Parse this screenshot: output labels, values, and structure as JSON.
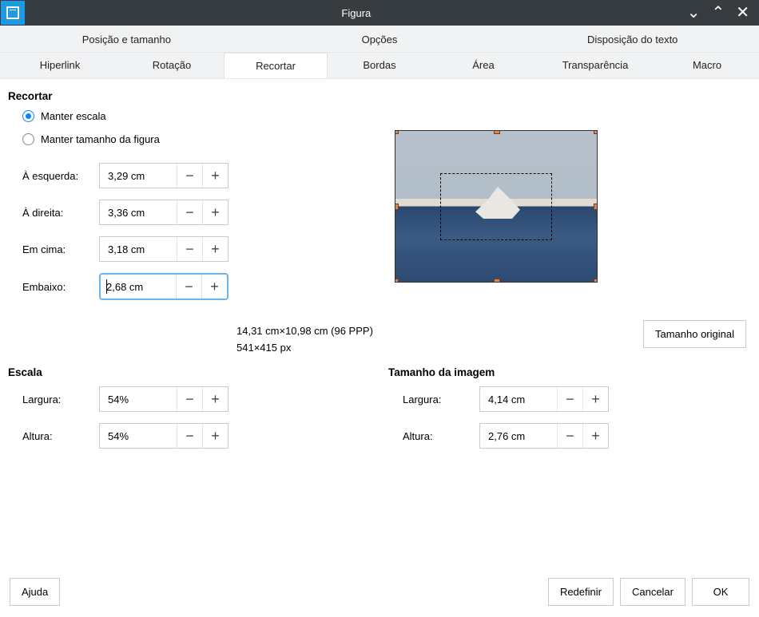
{
  "window": {
    "title": "Figura"
  },
  "tabs1": {
    "pos": "Posição e tamanho",
    "opt": "Opções",
    "textwrap": "Disposição do texto"
  },
  "tabs2": {
    "hyperlink": "Hiperlink",
    "rotation": "Rotação",
    "crop": "Recortar",
    "borders": "Bordas",
    "area": "Área",
    "transparency": "Transparência",
    "macro": "Macro"
  },
  "crop": {
    "heading": "Recortar",
    "keep_scale": "Manter escala",
    "keep_size": "Manter tamanho da figura",
    "left_label": "À esquerda:",
    "right_label": "À direita:",
    "top_label": "Em cima:",
    "bottom_label": "Embaixo:",
    "left": "3,29 cm",
    "right": "3,36 cm",
    "top": "3,18 cm",
    "bottom": "2,68 cm"
  },
  "info": {
    "line1": "14,31 cm×10,98 cm (96 PPP)",
    "line2": "541×415 px"
  },
  "size_original": "Tamanho original",
  "scale": {
    "heading": "Escala",
    "width_label": "Largura:",
    "height_label": "Altura:",
    "width": "54%",
    "height": "54%"
  },
  "imgsize": {
    "heading": "Tamanho da imagem",
    "width_label": "Largura:",
    "height_label": "Altura:",
    "width": "4,14 cm",
    "height": "2,76 cm"
  },
  "footer": {
    "help": "Ajuda",
    "reset": "Redefinir",
    "cancel": "Cancelar",
    "ok": "OK"
  }
}
